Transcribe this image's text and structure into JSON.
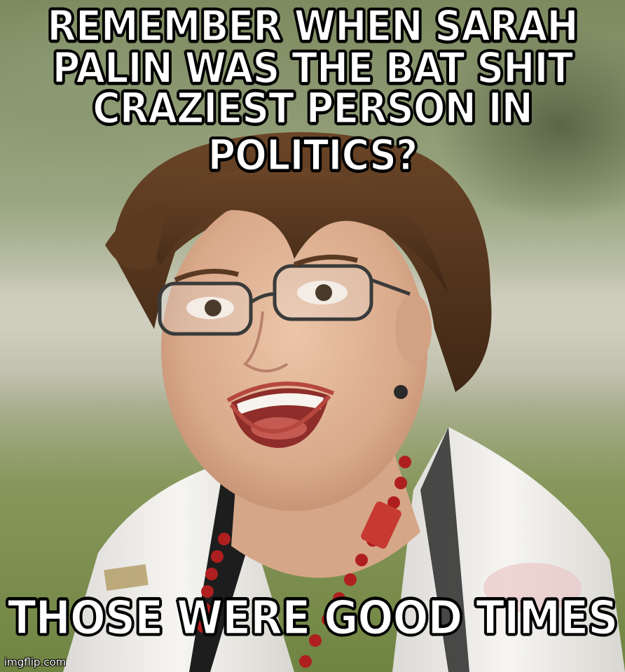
{
  "meme": {
    "top_lines": [
      "REMEMBER WHEN SARAH",
      "PALIN WAS THE BAT SHIT",
      "CRAZIEST PERSON IN POLITICS?"
    ],
    "bottom_text": "THOSE WERE GOOD TIMES",
    "watermark": "imgflip.com"
  },
  "colors": {
    "caption_fill": "#ffffff",
    "caption_outline": "#000000",
    "background_green": "#7d8a5f",
    "hair_brown": "#5a3a22",
    "skin": "#e1b89a",
    "jacket_white": "#f2f0ec",
    "necklace_red": "#b01f1f"
  },
  "icons": [
    "photo-subject"
  ]
}
